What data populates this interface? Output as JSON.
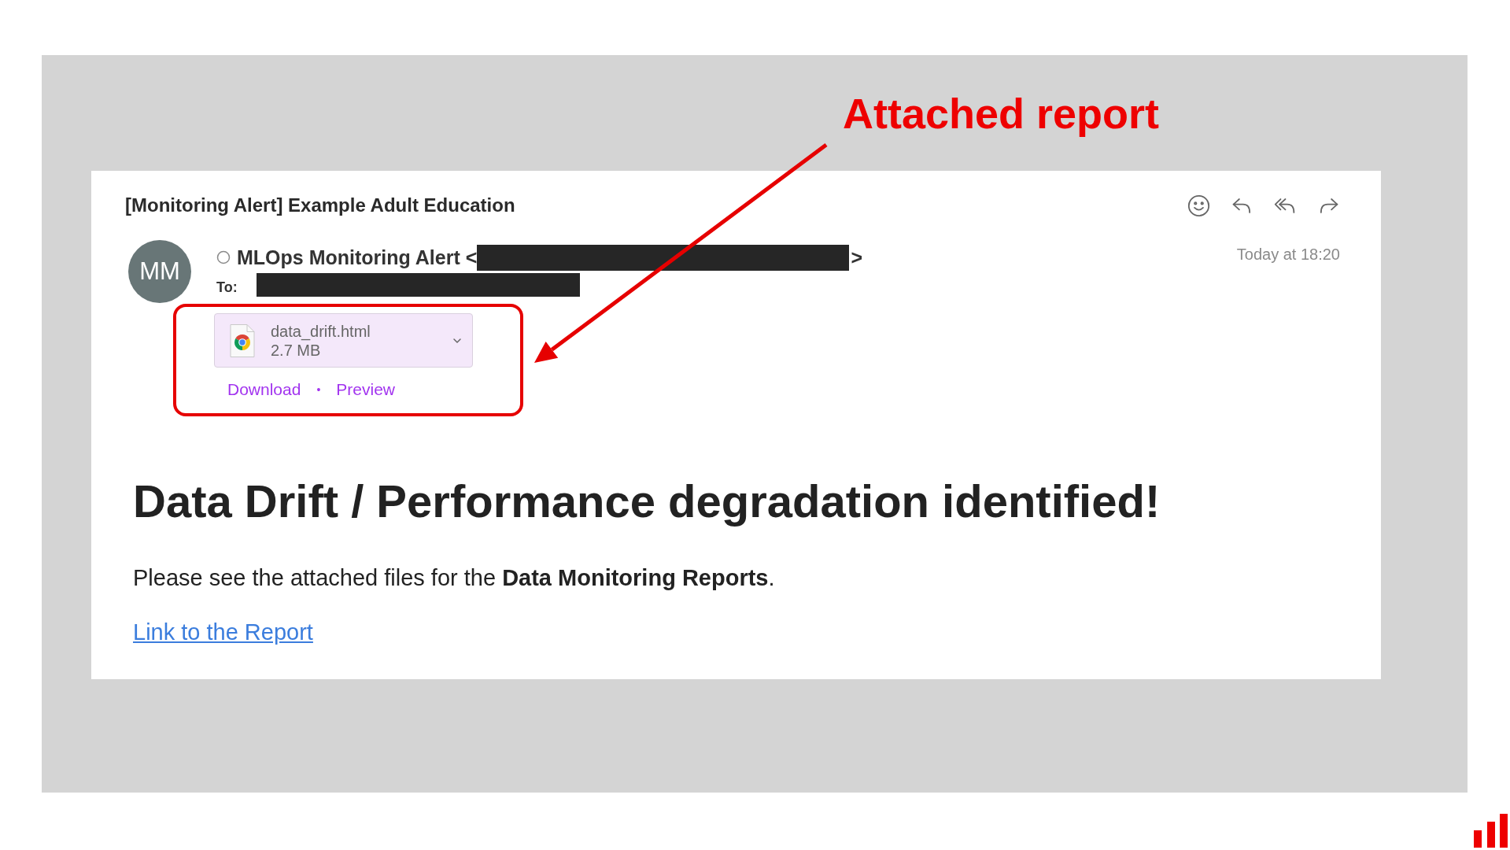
{
  "annotation": {
    "label": "Attached report"
  },
  "email": {
    "subject": "[Monitoring Alert] Example Adult Education",
    "avatar": {
      "initials": "MM"
    },
    "sender": {
      "name": "MLOps Monitoring Alert",
      "address_open": "<",
      "address_close": ">"
    },
    "date": "Today at 18:20",
    "to_label": "To:",
    "attachment": {
      "name": "data_drift.html",
      "size": "2.7 MB",
      "actions": [
        "Download",
        "Preview"
      ],
      "separator": "•"
    },
    "heading": "Data Drift / Performance degradation identified!",
    "body": "Please see the attached files for the **Data Monitoring Reports**.",
    "link": "Link to the Report"
  }
}
